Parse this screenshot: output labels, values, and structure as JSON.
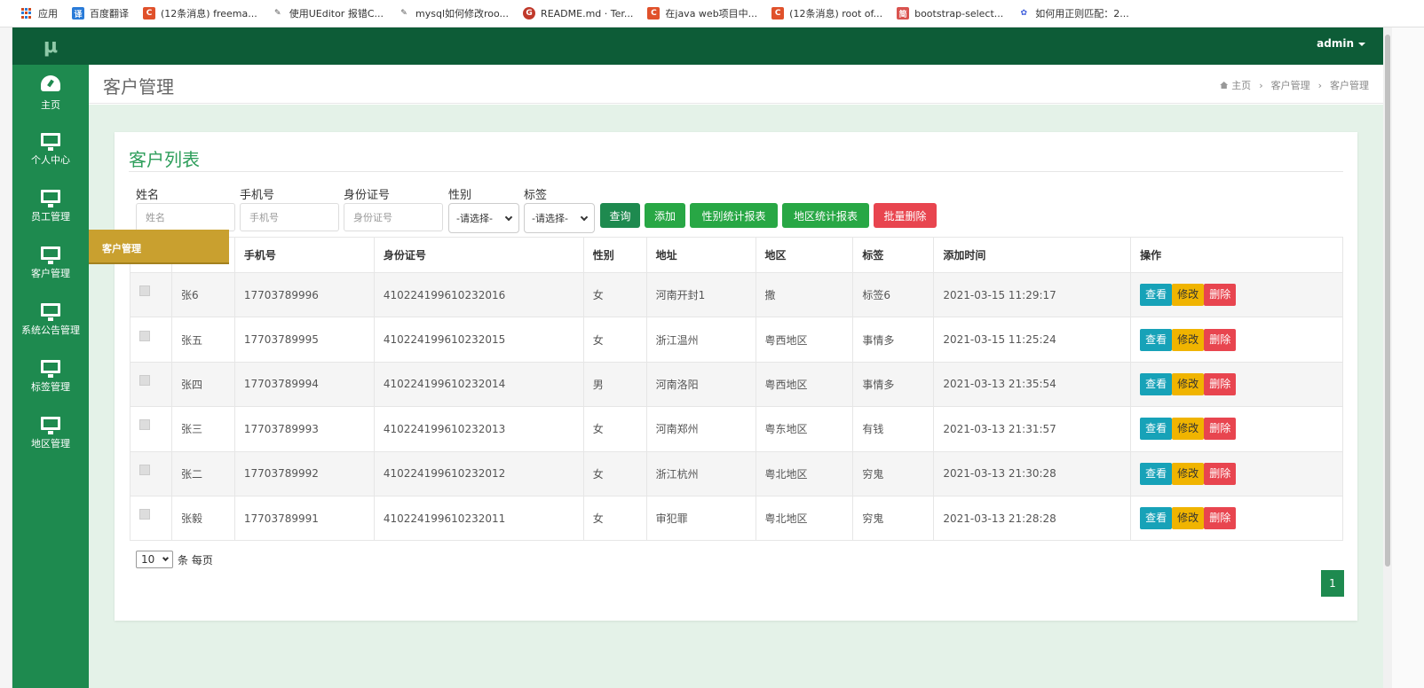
{
  "bookmarks": [
    {
      "label": "应用",
      "color": "#d04a1e"
    },
    {
      "label": "百度翻译",
      "color": "#2a7bd8",
      "glyph": "译"
    },
    {
      "label": "(12条消息) freema...",
      "color": "#e0512b",
      "glyph": "C"
    },
    {
      "label": "使用UEditor 报错C...",
      "color": "#555555",
      "glyph": "✎"
    },
    {
      "label": "mysql如何修改roo...",
      "color": "#555555",
      "glyph": "✎"
    },
    {
      "label": "README.md · Ter...",
      "color": "#c0392b",
      "glyph": "G"
    },
    {
      "label": "在java web项目中...",
      "color": "#e0512b",
      "glyph": "C"
    },
    {
      "label": "(12条消息) root of...",
      "color": "#e0512b",
      "glyph": "C"
    },
    {
      "label": "bootstrap-select...",
      "color": "#d9534f",
      "glyph": "简"
    },
    {
      "label": "如何用正则匹配：2...",
      "color": "#3b5bdb",
      "glyph": "✿"
    }
  ],
  "sidebar": {
    "logo": "μ",
    "items": [
      {
        "label": "主页",
        "icon": "dashboard-icon"
      },
      {
        "label": "个人中心",
        "icon": "monitor-icon"
      },
      {
        "label": "员工管理",
        "icon": "monitor-icon"
      },
      {
        "label": "客户管理",
        "icon": "monitor-icon"
      },
      {
        "label": "系统公告管理",
        "icon": "monitor-icon"
      },
      {
        "label": "标签管理",
        "icon": "monitor-icon"
      },
      {
        "label": "地区管理",
        "icon": "monitor-icon"
      }
    ],
    "flyout": "客户管理"
  },
  "header": {
    "user": "admin"
  },
  "pagehead": {
    "title": "客户管理",
    "breadcrumb": [
      "主页",
      "客户管理",
      "客户管理"
    ]
  },
  "card": {
    "title": "客户列表"
  },
  "filters": {
    "name_label": "姓名",
    "name_placeholder": "姓名",
    "phone_label": "手机号",
    "phone_placeholder": "手机号",
    "id_label": "身份证号",
    "id_placeholder": "身份证号",
    "gender_label": "性别",
    "gender_value": "-请选择-",
    "tag_label": "标签",
    "tag_value": "-请选择-"
  },
  "buttons": {
    "search": "查询",
    "add": "添加",
    "gender_report": "性别统计报表",
    "region_report": "地区统计报表",
    "batch_delete": "批量删除"
  },
  "colors": {
    "sidebar": "#1e8a4f",
    "topbar": "#0d5c37",
    "accent_green": "#28a745",
    "danger": "#e8454f",
    "info": "#17a2b8",
    "warning": "#f0b400",
    "flyout": "#c9a02f"
  },
  "table": {
    "columns": [
      "",
      "",
      "手机号",
      "身份证号",
      "性别",
      "地址",
      "地区",
      "标签",
      "添加时间",
      "操作"
    ],
    "rows": [
      {
        "name": "张6",
        "phone": "17703789996",
        "id": "410224199610232016",
        "gender": "女",
        "address": "河南开封1",
        "region": "撒",
        "tag": "标签6",
        "time": "2021-03-15 11:29:17"
      },
      {
        "name": "张五",
        "phone": "17703789995",
        "id": "410224199610232015",
        "gender": "女",
        "address": "浙江温州",
        "region": "粤西地区",
        "tag": "事情多",
        "time": "2021-03-15 11:25:24"
      },
      {
        "name": "张四",
        "phone": "17703789994",
        "id": "410224199610232014",
        "gender": "男",
        "address": "河南洛阳",
        "region": "粤西地区",
        "tag": "事情多",
        "time": "2021-03-13 21:35:54"
      },
      {
        "name": "张三",
        "phone": "17703789993",
        "id": "410224199610232013",
        "gender": "女",
        "address": "河南郑州",
        "region": "粤东地区",
        "tag": "有钱",
        "time": "2021-03-13 21:31:57"
      },
      {
        "name": "张二",
        "phone": "17703789992",
        "id": "410224199610232012",
        "gender": "女",
        "address": "浙江杭州",
        "region": "粤北地区",
        "tag": "穷鬼",
        "time": "2021-03-13 21:30:28"
      },
      {
        "name": "张毅",
        "phone": "17703789991",
        "id": "410224199610232011",
        "gender": "女",
        "address": "审犯罪",
        "region": "粤北地区",
        "tag": "穷鬼",
        "time": "2021-03-13 21:28:28"
      }
    ],
    "actions": {
      "view": "查看",
      "edit": "修改",
      "delete": "删除"
    }
  },
  "pagination": {
    "page_size": "10",
    "page_size_suffix": "条 每页",
    "current_page": "1"
  }
}
